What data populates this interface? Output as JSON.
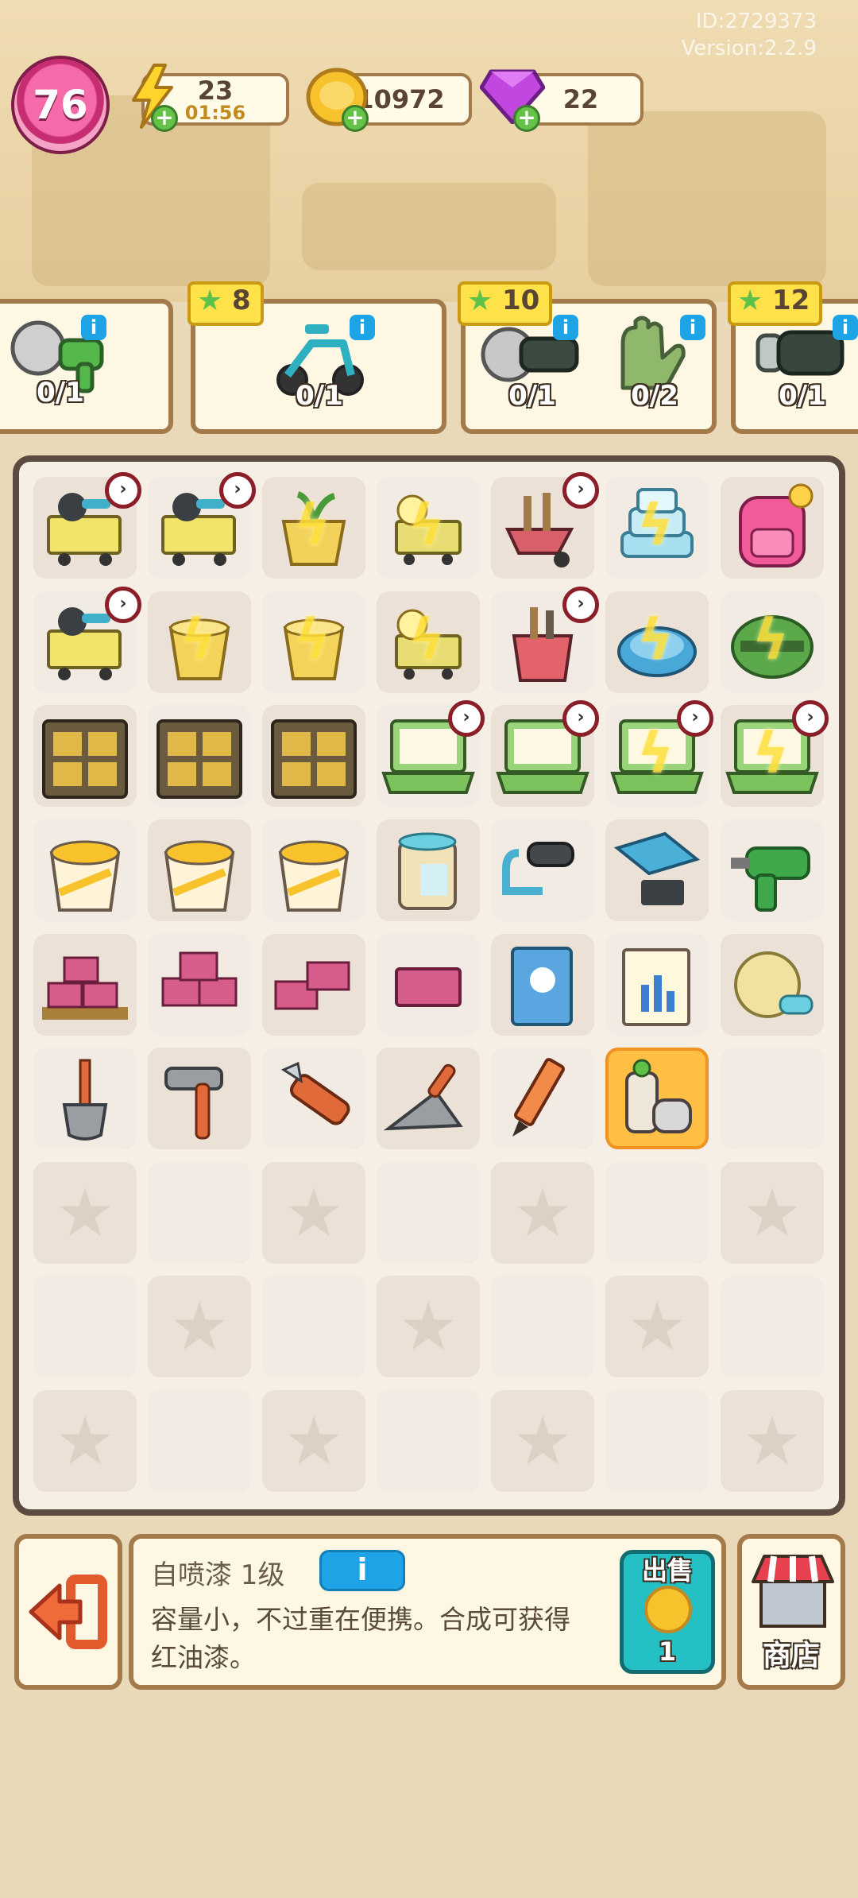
{
  "account": {
    "id": "ID:2729373",
    "version": "Version:2.2.9"
  },
  "level": "76",
  "resources": {
    "energy": {
      "value": "23",
      "timer": "01:56"
    },
    "coins": {
      "value": "10972"
    },
    "gems": {
      "value": "22"
    }
  },
  "orders": [
    {
      "stars": "",
      "items": [
        {
          "icon": "saw-drill-icon",
          "count": "0/1"
        }
      ]
    },
    {
      "stars": "8",
      "items": [
        {
          "icon": "scooter-icon",
          "count": "0/1"
        }
      ]
    },
    {
      "stars": "10",
      "items": [
        {
          "icon": "angle-grinder-icon",
          "count": "0/1"
        },
        {
          "icon": "gloves-icon",
          "count": "0/2"
        }
      ]
    },
    {
      "stars": "12",
      "items": [
        {
          "icon": "power-drill-icon",
          "count": "0/1"
        }
      ]
    }
  ],
  "board": {
    "rows": [
      [
        "cart-tools-icon",
        "cart-tools-icon",
        "seed-pot-icon",
        "duck-cart-icon",
        "wheelbarrow-icon",
        "glass-stack-icon",
        "backpack-icon"
      ],
      [
        "cart-tools-icon",
        "bucket-icon",
        "bucket-icon",
        "duck-cart-icon",
        "tool-bucket-icon",
        "robot-vacuum-icon",
        "green-machine-icon"
      ],
      [
        "cabinet-icon",
        "cabinet-icon",
        "cabinet-icon",
        "laptop-icon",
        "laptop-icon",
        "laptop-icon",
        "laptop-icon"
      ],
      [
        "paint-bucket-icon",
        "paint-bucket-icon",
        "paint-bucket-icon",
        "paint-can-icon",
        "paint-roller-icon",
        "tile-cutter-icon",
        "drill-icon"
      ],
      [
        "brick-pallet-icon",
        "bricks-icon",
        "bricks-small-icon",
        "brick-icon",
        "book-icon",
        "notepad-icon",
        "yarn-icon"
      ],
      [
        "shovel-icon",
        "hammer-icon",
        "utility-knife-icon",
        "trowel-icon",
        "pencil-icon",
        "spray-paint-icon",
        "empty"
      ],
      [
        "empty",
        "empty",
        "empty",
        "empty",
        "empty",
        "empty",
        "empty"
      ],
      [
        "empty",
        "empty",
        "empty",
        "empty",
        "empty",
        "empty",
        "empty"
      ],
      [
        "empty",
        "empty",
        "empty",
        "empty",
        "empty",
        "empty",
        "empty"
      ]
    ]
  },
  "selected_item": {
    "title": "自喷漆 1级",
    "info_label": "i",
    "description": "容量小，不过重在便携。合成可获得红油漆。",
    "sell_label": "出售",
    "sell_price": "1"
  },
  "shop_label": "商店",
  "colors": {
    "accent": "#1ea3e6",
    "frame": "#a37a4a",
    "selected": "#ffbf44"
  }
}
